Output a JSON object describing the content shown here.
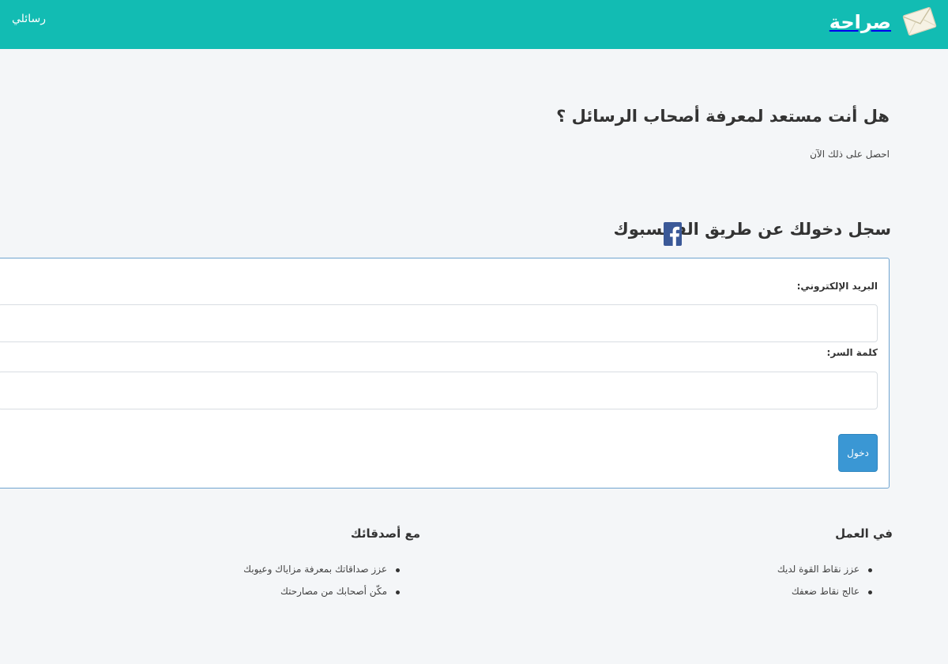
{
  "navbar": {
    "brand": "صراحة",
    "brand_icon": "envelope-icon",
    "my_messages": "رسائلي",
    "color": "#12bcb3"
  },
  "hero": {
    "title": "هل أنت مستعد لمعرفة أصحاب الرسائل ؟",
    "subtitle": "احصل على ذلك الآن"
  },
  "facebook": {
    "title": "سجل دخولك عن طريق الفايسبوك",
    "icon": "facebook-icon",
    "color": "#3b5998"
  },
  "login_form": {
    "email_label": "البريد الإلكتروني:",
    "email_value": "",
    "password_label": "كلمة السر:",
    "password_value": "",
    "submit_label": "دخول",
    "button_color": "#3a97d4"
  },
  "sections": {
    "work": {
      "title": "في العمل",
      "items": [
        "عزز نقاط القوة لديك",
        "عالج نقاط ضعفك"
      ]
    },
    "friends": {
      "title": "مع أصدقائك",
      "items": [
        "عزز صداقاتك بمعرفة مزاياك وعيوبك",
        "مكّن أصحابك من مصارحتك"
      ]
    }
  }
}
